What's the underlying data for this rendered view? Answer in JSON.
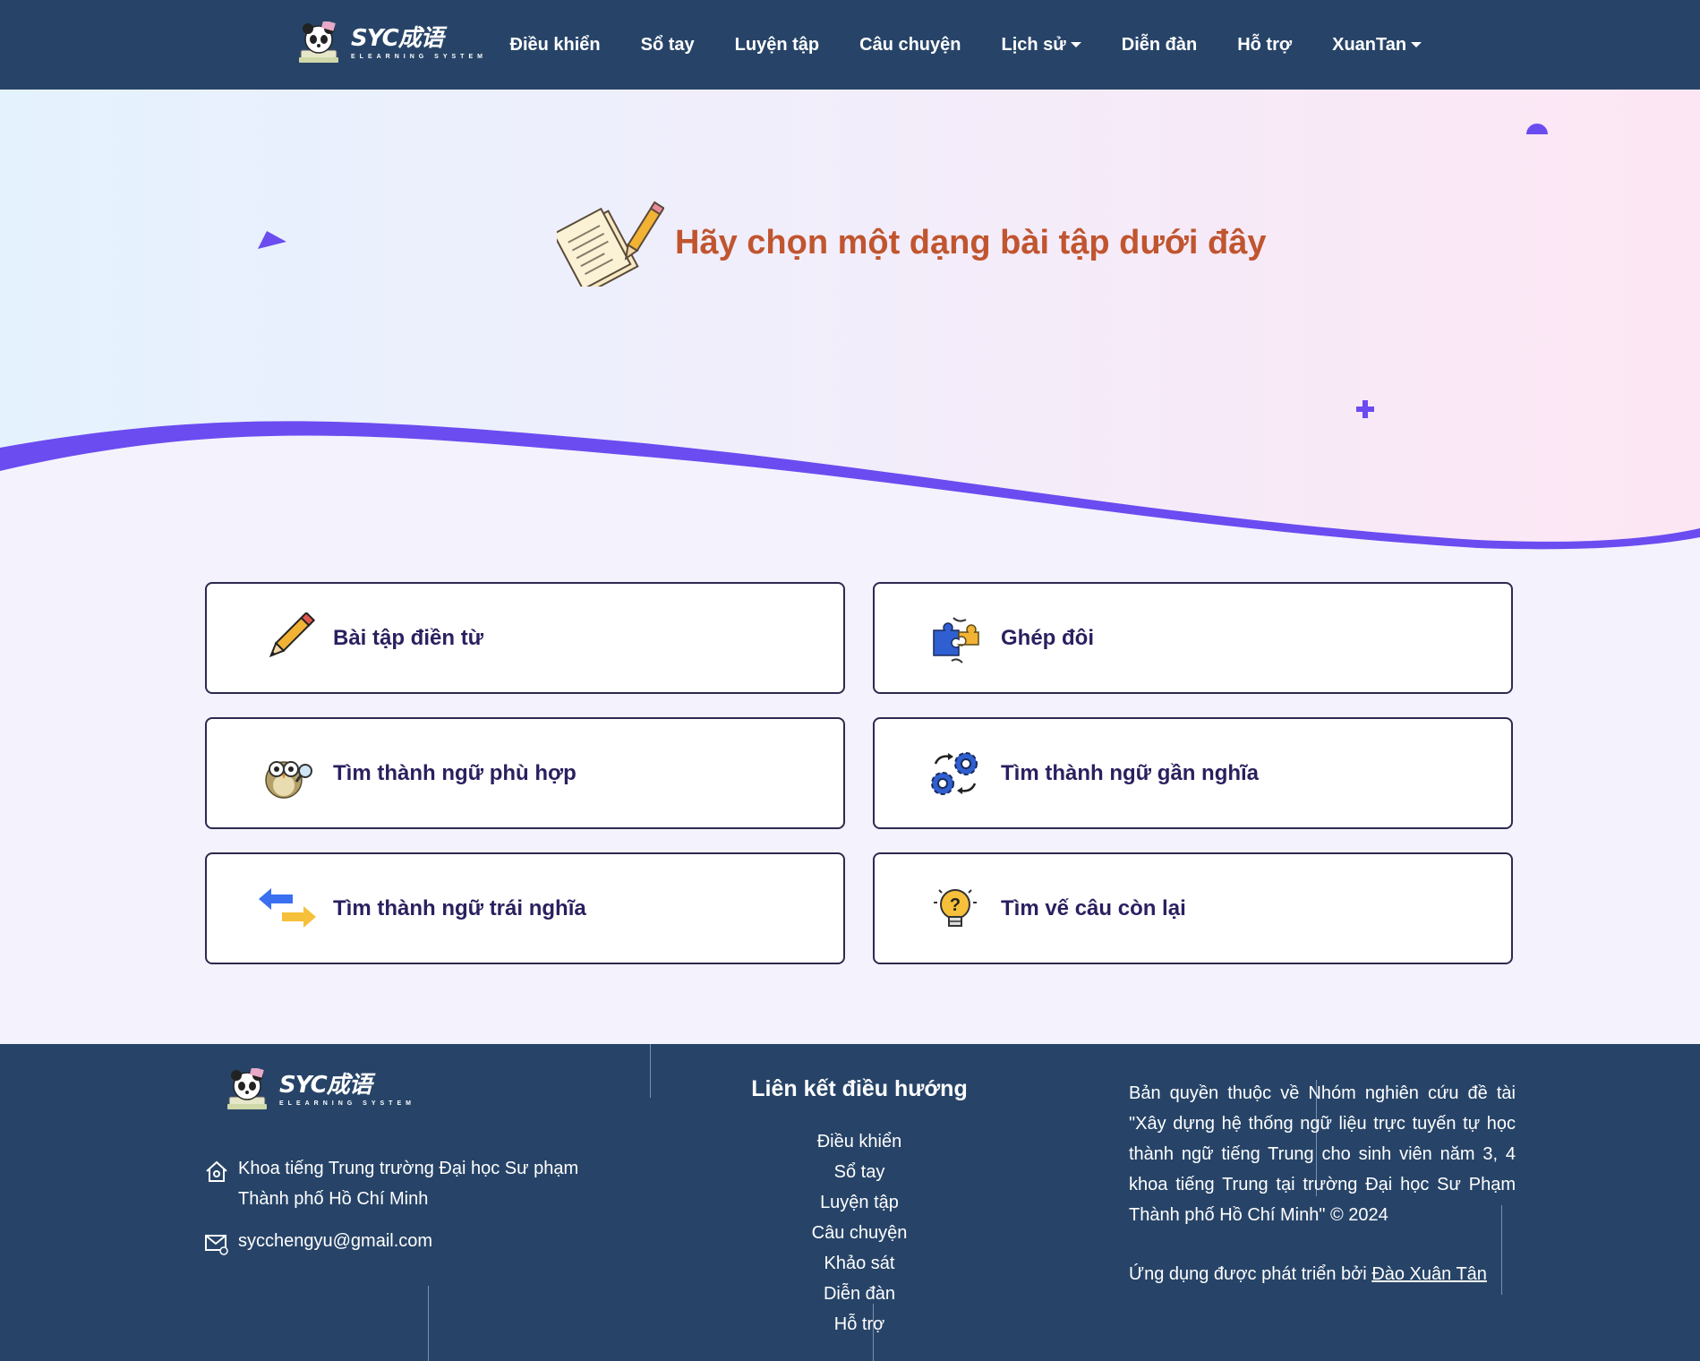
{
  "navbar": {
    "brand": "SYC成语",
    "brand_sub": "ELEARNING SYSTEM",
    "items": [
      {
        "label": "Điều khiển"
      },
      {
        "label": "Sổ tay"
      },
      {
        "label": "Luyện tập"
      },
      {
        "label": "Câu chuyện"
      },
      {
        "label": "Lịch sử",
        "dropdown": true
      },
      {
        "label": "Diễn đàn"
      },
      {
        "label": "Hỗ trợ"
      },
      {
        "label": "XuanTan",
        "dropdown": true
      }
    ]
  },
  "hero": {
    "title": "Hãy chọn một dạng bài tập dưới đây"
  },
  "exercises": [
    {
      "label": "Bài tập điền từ",
      "icon": "pencil-icon"
    },
    {
      "label": "Ghép đôi",
      "icon": "puzzle-icon"
    },
    {
      "label": "Tìm thành ngữ phù hợp",
      "icon": "owl-icon"
    },
    {
      "label": "Tìm thành ngữ gần nghĩa",
      "icon": "gears-icon"
    },
    {
      "label": "Tìm thành ngữ trái nghĩa",
      "icon": "swap-arrows-icon"
    },
    {
      "label": "Tìm vế câu còn lại",
      "icon": "lightbulb-icon"
    }
  ],
  "footer": {
    "brand": "SYC成语",
    "brand_sub": "ELEARNING SYSTEM",
    "address_line1": "Khoa tiếng Trung trường Đại học Sư phạm",
    "address_line2": "Thành phố Hồ Chí Minh",
    "email": "sycchengyu@gmail.com",
    "links_title": "Liên kết điều hướng",
    "links": [
      "Điều khiển",
      "Sổ tay",
      "Luyện tập",
      "Câu chuyện",
      "Khảo sát",
      "Diễn đàn",
      "Hỗ trợ"
    ],
    "copyright": "Bản quyền thuộc về Nhóm nghiên cứu đề tài \"Xây dựng hệ thống ngữ liệu trực tuyến tự học thành ngữ tiếng Trung cho sinh viên năm 3, 4 khoa tiếng Trung tại trường Đại học Sư Phạm Thành phố Hồ Chí Minh\" © 2024",
    "developed_prefix": "Ứng dụng được phát triển bởi",
    "developer": "Đào Xuân Tân"
  },
  "colors": {
    "navbar": "#274468",
    "accent_purple": "#6b4cf0",
    "title_orange": "#c0552f",
    "card_text": "#2b1f5f"
  }
}
